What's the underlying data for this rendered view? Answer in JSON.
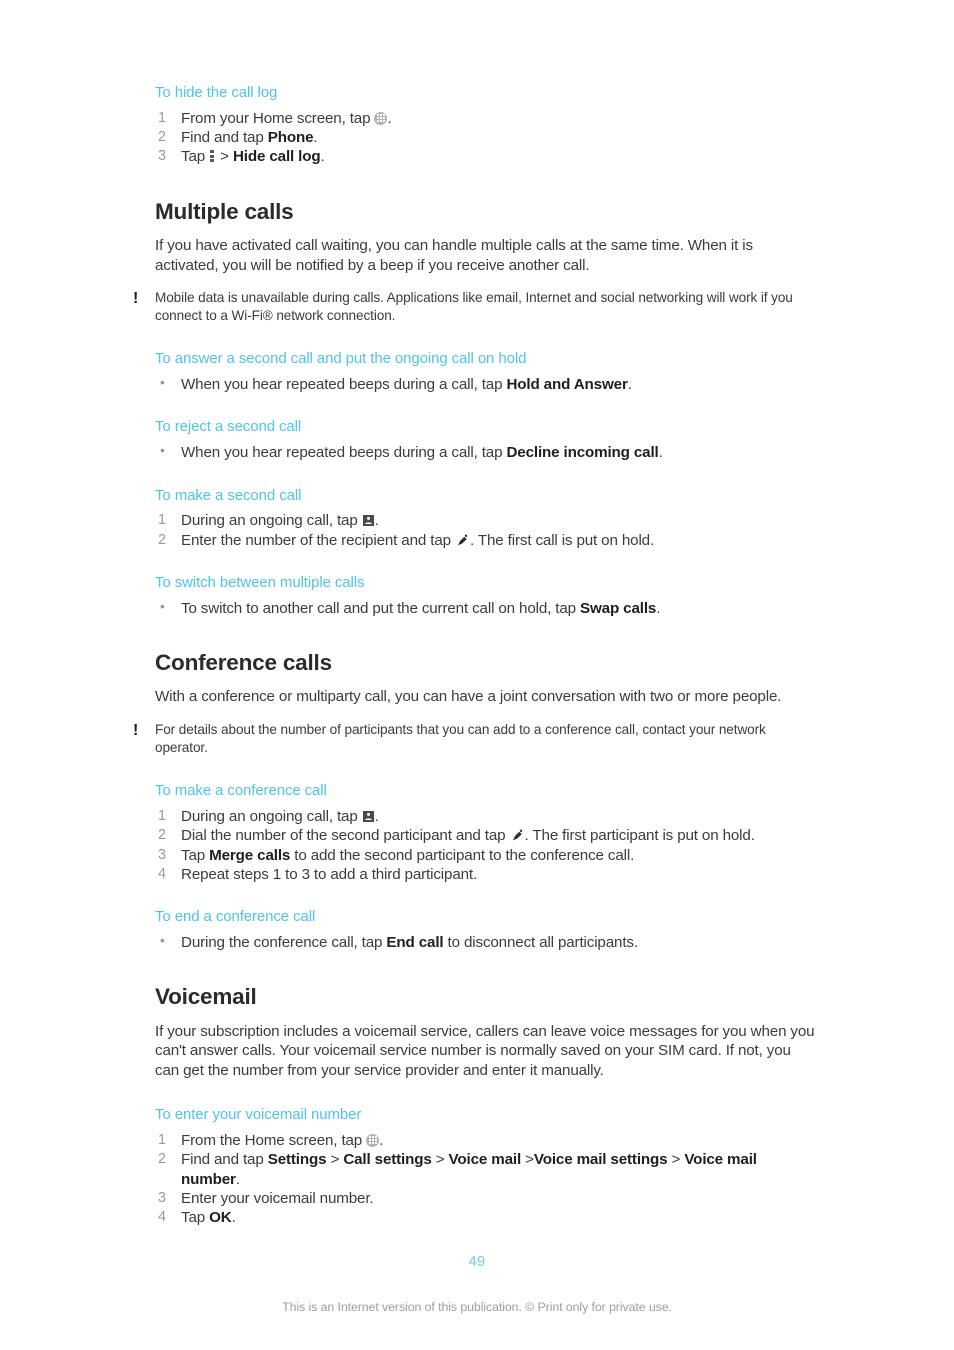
{
  "document": {
    "page_number": "49",
    "footer_note": "This is an Internet version of this publication. © Print only for private use.",
    "accent_color": "#4fc4e9",
    "body_color": "#3c3c3c"
  },
  "sections": [
    {
      "id": "hide-call-log",
      "task_title": "To hide the call log",
      "steps": [
        {
          "num": "1",
          "pre": "From your Home screen, tap ",
          "icon": "app-drawer-icon",
          "post": "."
        },
        {
          "num": "2",
          "pre": "Find and tap ",
          "bold": "Phone",
          "post": "."
        },
        {
          "num": "3",
          "pre": "Tap ",
          "icon": "overflow-menu-icon",
          "mid": " > ",
          "bold": "Hide call log",
          "post": "."
        }
      ]
    },
    {
      "id": "multiple-calls",
      "heading": "Multiple calls",
      "intro": "If you have activated call waiting, you can handle multiple calls at the same time. When it is activated, you will be notified by a beep if you receive another call.",
      "note_icon": "exclamation-icon",
      "note": "Mobile data is unavailable during calls. Applications like email, Internet and social networking will work if you connect to a Wi-Fi® network connection."
    },
    {
      "id": "answer-second-call",
      "task_title": "To answer a second call and put the ongoing call on hold",
      "bullets": [
        {
          "pre": "When you hear repeated beeps during a call, tap ",
          "bold": "Hold and Answer",
          "post": "."
        }
      ]
    },
    {
      "id": "reject-second-call",
      "task_title": "To reject a second call",
      "bullets": [
        {
          "pre": "When you hear repeated beeps during a call, tap ",
          "bold": "Decline incoming call",
          "post": "."
        }
      ]
    },
    {
      "id": "make-second-call",
      "task_title": "To make a second call",
      "steps": [
        {
          "num": "1",
          "pre": "During an ongoing call, tap ",
          "icon": "dialpad-icon",
          "post": "."
        },
        {
          "num": "2",
          "pre": "Enter the number of the recipient and tap ",
          "icon": "call-handset-icon",
          "post": ". The first call is put on hold."
        }
      ]
    },
    {
      "id": "switch-between-calls",
      "task_title": "To switch between multiple calls",
      "bullets": [
        {
          "pre": "To switch to another call and put the current call on hold, tap ",
          "bold": "Swap calls",
          "post": "."
        }
      ]
    },
    {
      "id": "conference-calls",
      "heading": "Conference calls",
      "intro": "With a conference or multiparty call, you can have a joint conversation with two or more people.",
      "note_icon": "exclamation-icon",
      "note": "For details about the number of participants that you can add to a conference call, contact your network operator."
    },
    {
      "id": "make-conference-call",
      "task_title": "To make a conference call",
      "steps": [
        {
          "num": "1",
          "pre": "During an ongoing call, tap ",
          "icon": "dialpad-icon",
          "post": "."
        },
        {
          "num": "2",
          "pre": "Dial the number of the second participant and tap ",
          "icon": "call-handset-icon",
          "post": ". The first participant is put on hold."
        },
        {
          "num": "3",
          "pre": "Tap ",
          "bold": "Merge calls",
          "post": " to add the second participant to the conference call."
        },
        {
          "num": "4",
          "pre": "Repeat steps 1 to 3 to add a third participant.",
          "post": ""
        }
      ]
    },
    {
      "id": "end-conference-call",
      "task_title": "To end a conference call",
      "bullets": [
        {
          "pre": "During the conference call, tap ",
          "bold": "End call",
          "post": " to disconnect all participants."
        }
      ]
    },
    {
      "id": "voicemail",
      "heading": "Voicemail",
      "intro": "If your subscription includes a voicemail service, callers can leave voice messages for you when you can't answer calls. Your voicemail service number is normally saved on your SIM card. If not, you can get the number from your service provider and enter it manually."
    },
    {
      "id": "enter-voicemail-number",
      "task_title": "To enter your voicemail number",
      "steps": [
        {
          "num": "1",
          "pre": "From the Home screen, tap ",
          "icon": "app-drawer-icon",
          "post": "."
        },
        {
          "num": "2",
          "pre": "Find and tap ",
          "bold_path": "Settings > Call settings > Voice mail >Voice mail settings > Voice mail number",
          "post": "."
        },
        {
          "num": "3",
          "pre": "Enter your voicemail number.",
          "post": ""
        },
        {
          "num": "4",
          "pre": "Tap ",
          "bold": "OK",
          "post": "."
        }
      ]
    }
  ]
}
